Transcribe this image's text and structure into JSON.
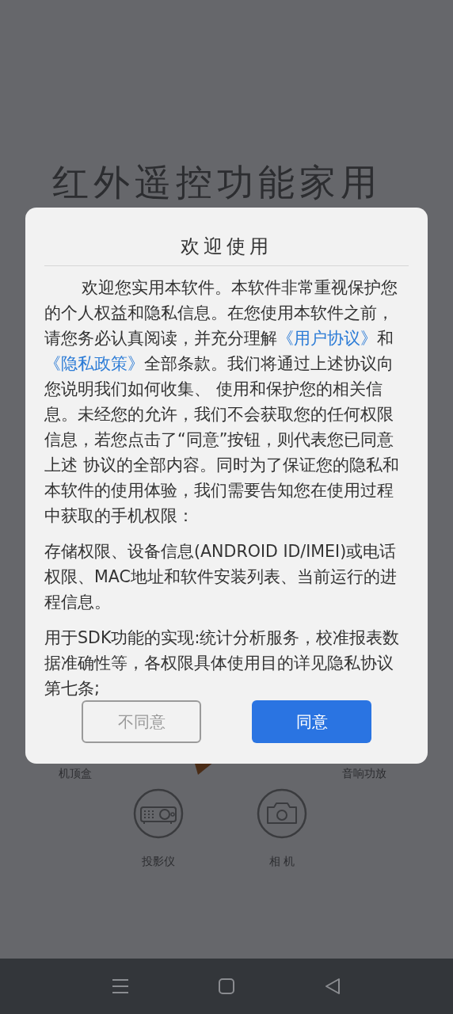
{
  "background": {
    "heading": "红外遥控功能家用",
    "top_labels": [
      "机顶盒",
      "音响功放"
    ],
    "devices": [
      {
        "label": "投影仪",
        "kind": "projector"
      },
      {
        "label": "相 机",
        "kind": "camera"
      }
    ]
  },
  "dialog": {
    "title": "欢迎使用",
    "paragraphs": [
      {
        "indent": true,
        "segments": [
          {
            "kind": "text",
            "text": "欢迎您实用本软件。本软件非常重视保护您的个人权益和隐私信息。在您使用本软件之前，请您务必认真阅读，并充分理解"
          },
          {
            "kind": "link",
            "text": "《用户协议》"
          },
          {
            "kind": "text",
            "text": "和"
          },
          {
            "kind": "link",
            "text": "《隐私政策》"
          },
          {
            "kind": "text",
            "text": "全部条款。我们将通过上述协议向您说明我们如何收集、 使用和保护您的相关信息。未经您的允许，我们不会获取您的任何权限信息，若您点击了“同意”按钮，则代表您已同意上述 协议的全部内容。同时为了保证您的隐私和本软件的使用体验，我们需要告知您在使用过程中获取的手机权限："
          }
        ]
      },
      {
        "indent": false,
        "segments": [
          {
            "kind": "text",
            "text": "存储权限、设备信息(ANDROID ID/IMEI)或电话权限、MAC地址和软件安装列表、当前运行的进程信息。"
          }
        ]
      },
      {
        "indent": false,
        "segments": [
          {
            "kind": "text",
            "text": "用于SDK功能的实现:统计分析服务，校准报表数据准确性等，各权限具体使用目的详见隐私协议第七条;"
          }
        ]
      }
    ],
    "buttons": [
      {
        "label": "不同意",
        "kind": "secondary"
      },
      {
        "label": "同意",
        "kind": "primary"
      }
    ]
  }
}
